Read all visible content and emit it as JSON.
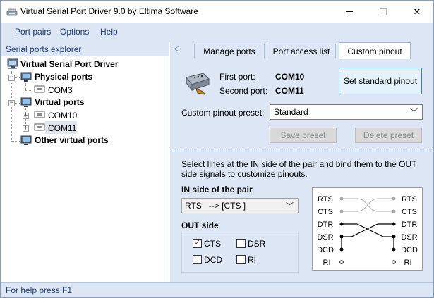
{
  "window": {
    "title": "Virtual Serial Port Driver 9.0 by Eltima Software"
  },
  "menu": [
    "Port pairs",
    "Options",
    "Help"
  ],
  "explorer": {
    "header": "Serial ports explorer",
    "root": "Virtual Serial Port Driver",
    "physical_ports": {
      "label": "Physical ports",
      "items": [
        "COM3"
      ]
    },
    "virtual_ports": {
      "label": "Virtual ports",
      "items": [
        "COM10",
        "COM11"
      ],
      "selected": "COM11"
    },
    "other": "Other virtual ports"
  },
  "tabs": {
    "manage": "Manage ports",
    "access": "Port access list",
    "custom": "Custom pinout",
    "active": "Custom pinout"
  },
  "pinout": {
    "first_port_label": "First port:",
    "first_port_value": "COM10",
    "second_port_label": "Second port:",
    "second_port_value": "COM11",
    "set_standard_button": "Set standard pinout",
    "preset_label": "Custom pinout preset:",
    "preset_value": "Standard",
    "save_preset_button": "Save preset",
    "delete_preset_button": "Delete preset",
    "instructions": "Select lines at the IN side of the pair and bind them to the OUT side signals to customize pinouts.",
    "in_side_label": "IN side of the pair",
    "in_side_value": "RTS   --> [CTS ]",
    "out_side_label": "OUT side",
    "out_checkboxes": [
      {
        "label": "CTS",
        "checked": true
      },
      {
        "label": "DSR",
        "checked": false
      },
      {
        "label": "DCD",
        "checked": false
      },
      {
        "label": "RI",
        "checked": false
      }
    ],
    "diagram": {
      "left": [
        "RTS",
        "CTS",
        "DTR",
        "DSR",
        "DCD",
        "RI"
      ],
      "right": [
        "RTS",
        "CTS",
        "DTR",
        "DSR",
        "DCD",
        "RI"
      ]
    }
  },
  "status": "For help press F1",
  "colors": {
    "accent": "#1e3f73",
    "panel": "#dce6f4",
    "selection": "#dfe6ee"
  }
}
